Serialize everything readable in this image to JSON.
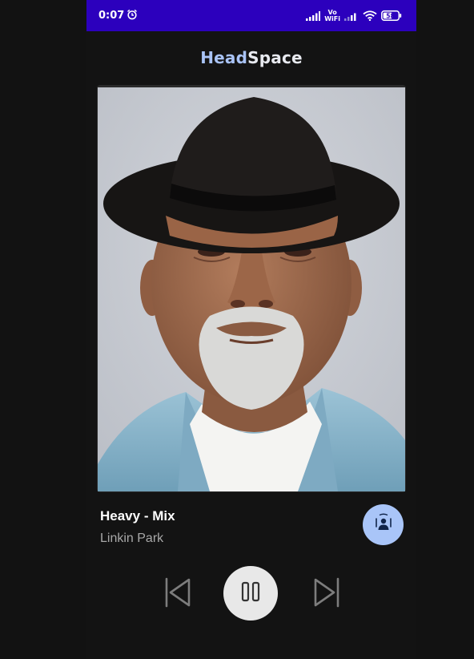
{
  "status_bar": {
    "time": "0:07",
    "network_tag_top": "Vo",
    "network_tag_bottom": "WiFi",
    "battery": "58"
  },
  "app": {
    "title_part1": "Head",
    "title_part2": "Space"
  },
  "player": {
    "track_title": "Heavy - Mix",
    "artist": "Linkin Park",
    "is_playing": true
  },
  "icons": {
    "alarm": "alarm-clock-icon",
    "signal": "signal-icon",
    "wifi": "wifi-icon",
    "battery": "battery-icon",
    "cast": "speaker-device-icon",
    "previous": "skip-previous-icon",
    "pause": "pause-icon",
    "next": "skip-next-icon"
  },
  "colors": {
    "status_bar": "#2c00bd",
    "background": "#131313",
    "accent": "#a9c5f8",
    "play_button": "#e8e8e8"
  }
}
